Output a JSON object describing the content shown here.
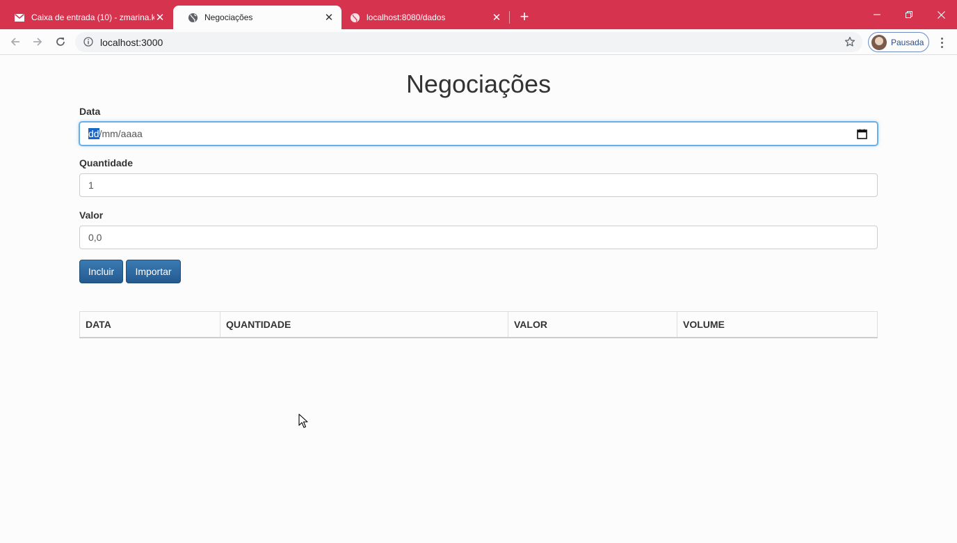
{
  "browser": {
    "tabs": [
      {
        "title": "Caixa de entrada (10) - zmarina.k",
        "icon": "gmail-icon",
        "active": false
      },
      {
        "title": "Negociações",
        "icon": "globe-icon",
        "active": true
      },
      {
        "title": "localhost:8080/dados",
        "icon": "globe-icon",
        "active": false
      }
    ],
    "url": "localhost:3000",
    "profile_label": "Pausada",
    "theme_color": "#d6334f"
  },
  "page": {
    "title": "Negociações",
    "form": {
      "date_label": "Data",
      "date_segment_selected": "dd",
      "date_rest": "/mm/aaaa",
      "quantity_label": "Quantidade",
      "quantity_value": "1",
      "value_label": "Valor",
      "value_value": "0,0"
    },
    "buttons": {
      "include": "Incluir",
      "import": "Importar"
    },
    "table": {
      "headers": [
        "DATA",
        "QUANTIDADE",
        "VALOR",
        "VOLUME"
      ],
      "rows": []
    },
    "colors": {
      "button": "#2e6da4",
      "focus": "#66afe9"
    }
  }
}
